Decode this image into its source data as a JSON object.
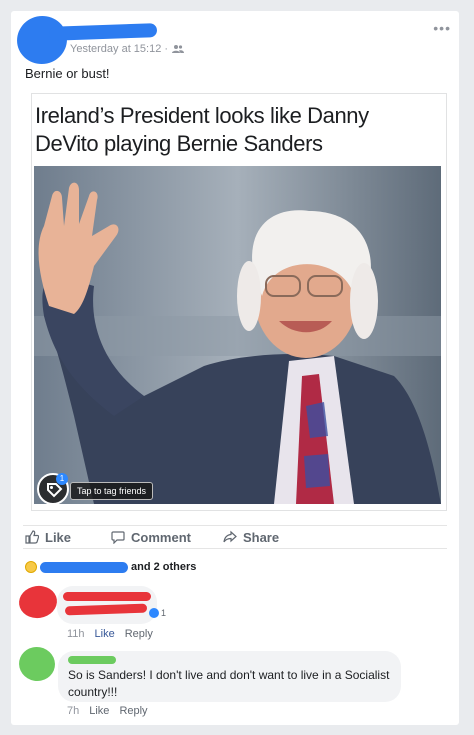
{
  "post": {
    "timestamp": "Yesterday at 15:12 ·",
    "audience_icon": "friends-icon",
    "more_icon": "•••",
    "text": "Bernie or bust!"
  },
  "shared_image": {
    "caption": "Ireland’s President looks like Danny DeVito playing Bernie Sanders",
    "tag_badge": "1",
    "tag_label": "Tap to tag friends"
  },
  "actions": {
    "like": "Like",
    "comment": "Comment",
    "share": "Share"
  },
  "reactions": {
    "icon": "haha-icon",
    "others_text": "and 2 others"
  },
  "comments": [
    {
      "time": "11h",
      "like": "Like",
      "reply": "Reply",
      "like_count": "1"
    },
    {
      "text": "So is Sanders!  I don't live and don't want to live in a Socialist country!!!",
      "time": "7h",
      "like": "Like",
      "reply": "Reply"
    }
  ],
  "colors": {
    "redaction_blue": "#2d7cf0",
    "redaction_red": "#e8343a",
    "redaction_green": "#6ccb5f",
    "link": "#385898"
  }
}
